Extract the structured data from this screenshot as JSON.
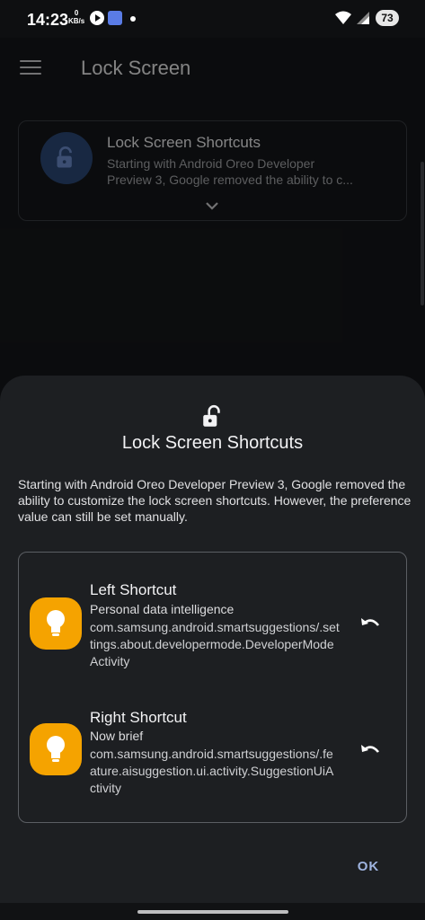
{
  "status_bar": {
    "time": "14:23",
    "net_value": "0",
    "net_unit": "KB/s",
    "battery": "73"
  },
  "app_bar": {
    "title": "Lock Screen",
    "menu_icon": "hamburger-menu-icon"
  },
  "preference": {
    "title": "Lock Screen Shortcuts",
    "description_line1": "Starting with Android Oreo Developer",
    "description_line2": "Preview 3, Google removed the ability to c...",
    "icon": "lock-open-icon",
    "expand_icon": "chevron-down-icon"
  },
  "dialog": {
    "icon": "lock-open-icon",
    "title": "Lock Screen Shortcuts",
    "description": "Starting with Android Oreo Developer Preview 3, Google removed the ability to customize the lock screen shortcuts. However, the preference value can still be set manually.",
    "shortcuts": [
      {
        "title": "Left Shortcut",
        "subtitle": "Personal data intelligence",
        "package": "com.samsung.android.smartsuggestions/.settings.about.developermode.DeveloperModeActivity",
        "icon": "lightbulb-icon",
        "reset_icon": "undo-icon"
      },
      {
        "title": "Right Shortcut",
        "subtitle": "Now brief",
        "package": "com.samsung.android.smartsuggestions/.feature.aisuggestion.ui.activity.SuggestionUiActivity",
        "icon": "lightbulb-icon",
        "reset_icon": "undo-icon"
      }
    ],
    "ok_label": "OK"
  },
  "colors": {
    "accent": "#9fb4e0",
    "app_icon": "#f5a300",
    "sheet_bg": "#1d1f22"
  }
}
